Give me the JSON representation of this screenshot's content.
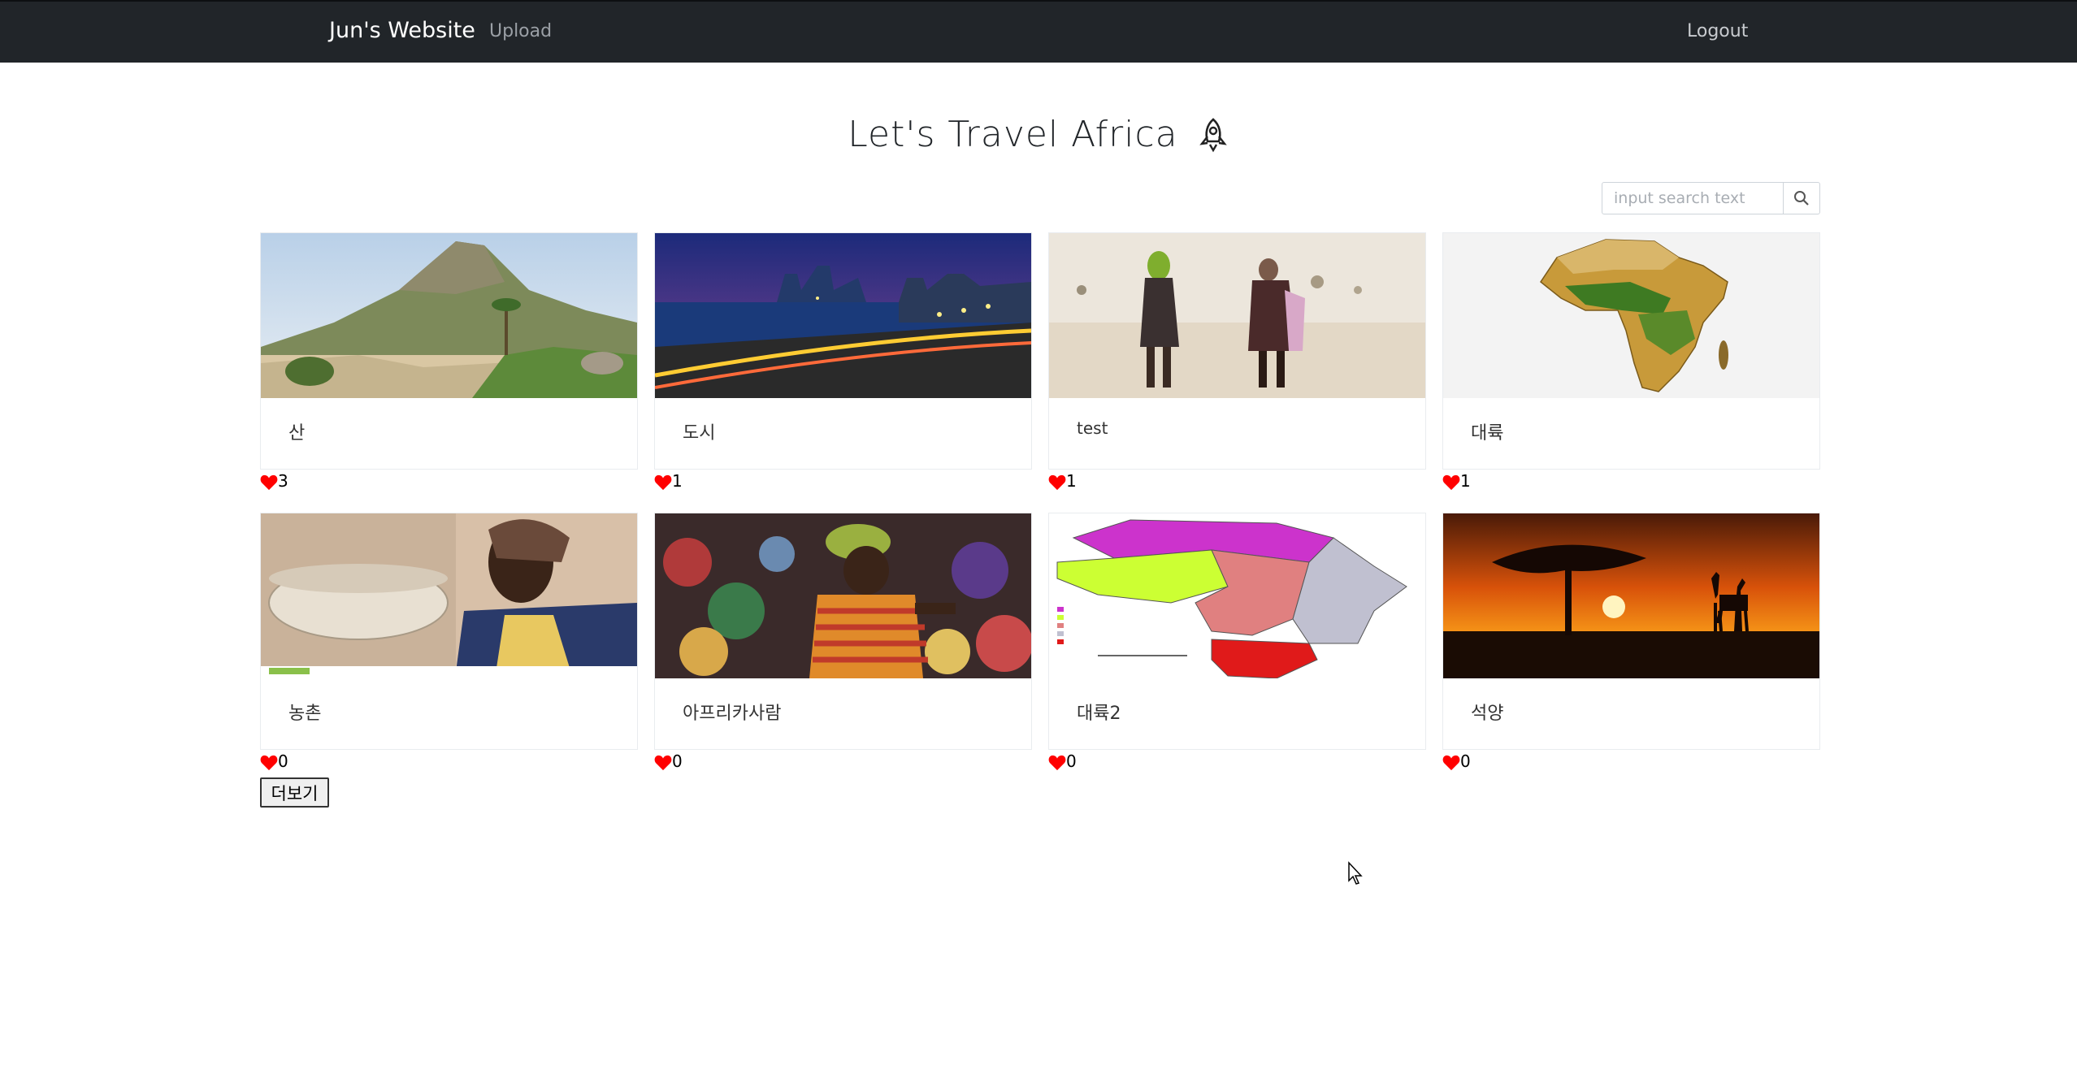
{
  "navbar": {
    "brand": "Jun's Website",
    "upload": "Upload",
    "logout": "Logout"
  },
  "header": {
    "title": "Let's Travel Africa",
    "icon": "rocket-icon"
  },
  "search": {
    "placeholder": "input search text",
    "icon": "search-icon"
  },
  "cards": [
    {
      "title": "산",
      "likes": "3",
      "image": "mountain-coast-photo"
    },
    {
      "title": "도시",
      "likes": "1",
      "image": "night-city-photo"
    },
    {
      "title": "test",
      "likes": "1",
      "image": "women-walking-desert-photo"
    },
    {
      "title": "대륙",
      "likes": "1",
      "image": "africa-relief-map"
    },
    {
      "title": "농촌",
      "likes": "0",
      "image": "woman-carrying-bowl-photo"
    },
    {
      "title": "아프리카사람",
      "likes": "0",
      "image": "market-woman-photo"
    },
    {
      "title": "대륙2",
      "likes": "0",
      "image": "africa-regions-map"
    },
    {
      "title": "석양",
      "likes": "0",
      "image": "savanna-sunset-photo"
    }
  ],
  "more_button": "더보기",
  "colors": {
    "navbar": "#212529",
    "heart": "#ff0000"
  }
}
